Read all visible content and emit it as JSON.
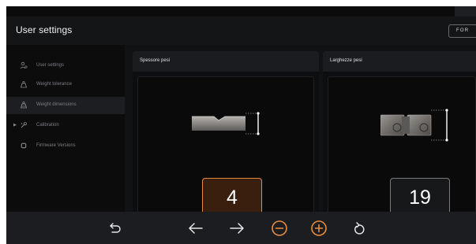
{
  "header": {
    "title": "User settings",
    "for_button": "FOR"
  },
  "sidebar": {
    "items": [
      {
        "label": "User settings",
        "icon": "user-settings-icon"
      },
      {
        "label": "Weight tolerance",
        "icon": "scale-icon"
      },
      {
        "label": "Weight dimensions",
        "icon": "scale-icon"
      },
      {
        "label": "Calibration",
        "icon": "calibration-icon"
      },
      {
        "label": "Firmware Versions",
        "icon": "chip-icon"
      }
    ],
    "active_index": 2
  },
  "panels": [
    {
      "title": "Spessore pesi",
      "value": "4",
      "selected": true
    },
    {
      "title": "Larghezze pesi",
      "value": "19",
      "selected": false
    }
  ],
  "bottom_bar": {
    "buttons": [
      "undo-icon",
      "arrow-left-icon",
      "arrow-right-icon",
      "minus-circle-icon",
      "plus-circle-icon",
      "reset-icon"
    ]
  },
  "colors": {
    "accent": "#e98b3d",
    "background": "#111214",
    "selected_fill": "#3a1e0e"
  }
}
